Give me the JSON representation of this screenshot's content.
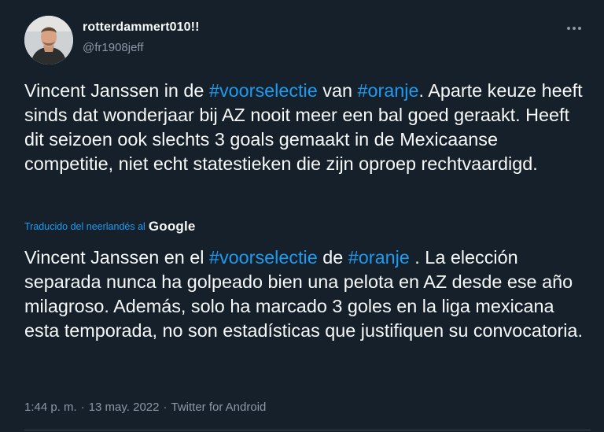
{
  "author": {
    "name": "rotterdammert010!!",
    "handle": "@fr1908jeff"
  },
  "icons": {
    "avatar": "profile-photo",
    "more": "more-options-icon"
  },
  "tweet": {
    "original": {
      "line1_prefix": "Vincent Janssen in de ",
      "hashtag1": "#voorselectie",
      "line1_middle": " van ",
      "hashtag2": "#oranje",
      "line1_suffix": ".",
      "rest": "Aparte keuze heeft sinds dat wonderjaar bij AZ nooit meer een bal goed geraakt. Heeft dit seizoen ook slechts 3 goals gemaakt in de Mexicaanse competitie, niet echt statestieken die zijn oproep rechtvaardigd."
    },
    "translated_by": {
      "label": "Traducido del neerlandés al",
      "provider": "Google"
    },
    "translation": {
      "prefix": "Vincent Janssen en el ",
      "hashtag1": "#voorselectie",
      "middle": " de ",
      "hashtag2": "#oranje",
      "suffix": " . La elección separada nunca ha golpeado bien una pelota en AZ desde ese año milagroso. Además, solo ha marcado 3 goles en la liga mexicana esta temporada, no son estadísticas que justifiquen su convocatoria."
    },
    "meta": {
      "time": "1:44 p. m.",
      "sep1": "·",
      "date": "13 may. 2022",
      "sep2": "·",
      "source": "Twitter for Android"
    }
  },
  "colors": {
    "background": "#15202b",
    "text": "#f7f9f9",
    "secondary": "#8b98a5",
    "accent": "#1d9bf0"
  }
}
